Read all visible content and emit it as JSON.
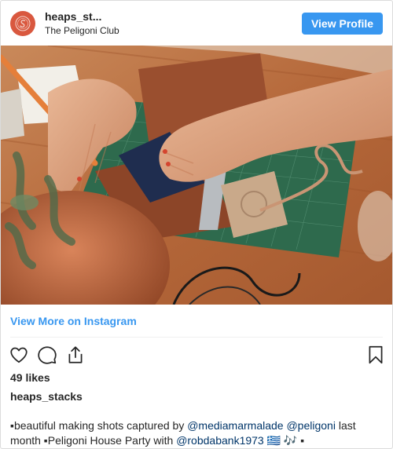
{
  "header": {
    "username": "heaps_st...",
    "location": "The Peligoni Club",
    "view_profile_label": "View Profile"
  },
  "post": {
    "image_alt": "Hands crafting a leather card holder on a green cutting mat",
    "view_more_label": "View More on Instagram",
    "likes": "49 likes",
    "caption_username": "heaps_stacks",
    "caption": {
      "part1": "▪beautiful making shots captured by ",
      "mention1": "@mediamarmalade",
      "space1": " ",
      "mention2": "@peligoni",
      "part2": " last month ▪Peligoni House Party with ",
      "mention3": "@robdabank1973",
      "part3": " 🇬🇷 🎶 ▪"
    }
  },
  "icons": {
    "like": "heart-icon",
    "comment": "comment-icon",
    "share": "share-icon",
    "save": "bookmark-icon"
  },
  "colors": {
    "accent": "#3897f0",
    "mention": "#003569",
    "avatar": "#d9583f"
  }
}
